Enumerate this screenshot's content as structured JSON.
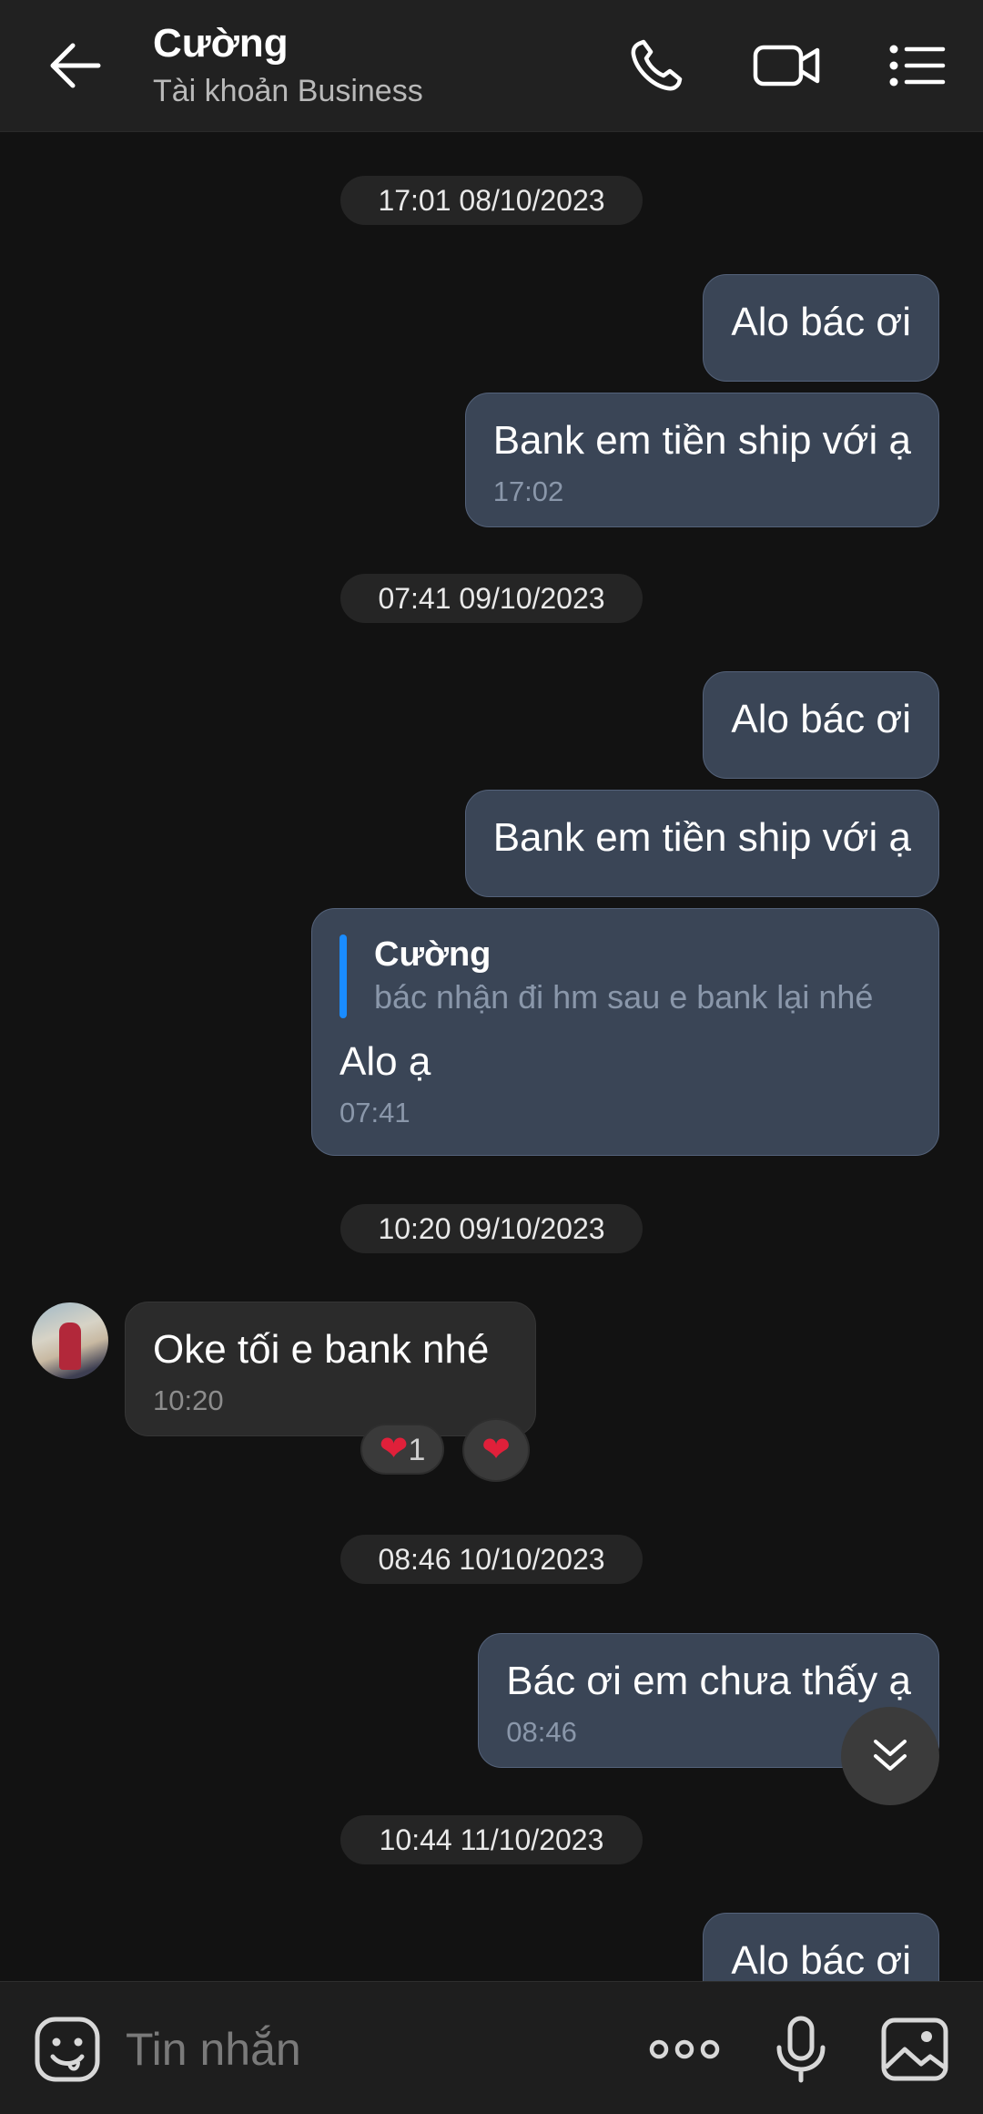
{
  "header": {
    "title": "Cường",
    "subtitle": "Tài khoản Business",
    "icons": [
      "back-arrow-icon",
      "phone-icon",
      "video-call-icon",
      "list-menu-icon"
    ]
  },
  "dates": [
    "17:01 08/10/2023",
    "07:41 09/10/2023",
    "10:20 09/10/2023",
    "08:46 10/10/2023",
    "10:44 11/10/2023"
  ],
  "messages": {
    "m1": {
      "text": "Alo bác ơi"
    },
    "m2": {
      "text": "Bank em tiền ship với ạ",
      "time": "17:02"
    },
    "m3": {
      "text": "Alo bác ơi"
    },
    "m4": {
      "text": "Bank em tiền ship với ạ"
    },
    "m5": {
      "quote_name": "Cường",
      "quote_text": "bác nhận đi hm sau e bank lại nhé",
      "text": "Alo ạ",
      "time": "07:41"
    },
    "m6": {
      "text": "Oke tối e bank nhé",
      "time": "10:20",
      "reaction_count": "1"
    },
    "m7": {
      "text": "Bác ơi em chưa thấy ạ",
      "time": "08:46"
    },
    "m8": {
      "text": "Alo bác ơi"
    }
  },
  "composer": {
    "placeholder": "Tin nhắn",
    "icons": [
      "sticker-icon",
      "more-icon",
      "microphone-icon",
      "image-icon"
    ]
  },
  "colors": {
    "outgoing_bubble": "#3a4556",
    "incoming_bubble": "#2b2b2b",
    "quote_bar": "#1a8cff",
    "heart": "#e0203a"
  }
}
